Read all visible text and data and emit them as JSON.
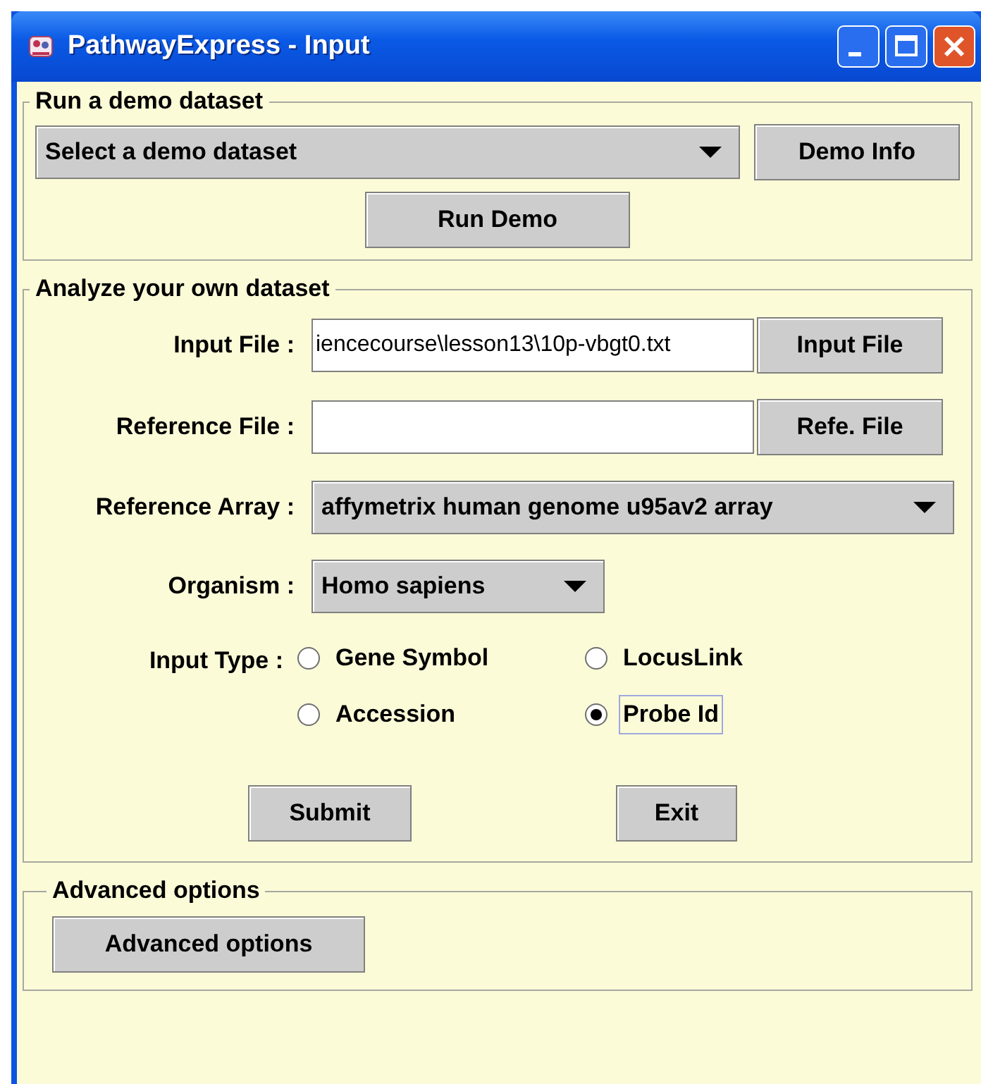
{
  "window": {
    "title": "PathwayExpress - Input"
  },
  "demo": {
    "legend": "Run a demo dataset",
    "dropdown": {
      "value": "Select a demo dataset"
    },
    "info_button": "Demo Info",
    "run_button": "Run Demo"
  },
  "analyze": {
    "legend": "Analyze your own dataset",
    "input_file": {
      "label": "Input File :",
      "value": "iencecourse\\lesson13\\10p-vbgt0.txt",
      "button": "Input File"
    },
    "reference_file": {
      "label": "Reference File :",
      "button": "Refe. File"
    },
    "reference_array": {
      "label": "Reference Array :",
      "value": "affymetrix human genome u95av2 array"
    },
    "organism": {
      "label": "Organism :",
      "value": "Homo sapiens"
    },
    "input_type": {
      "label": "Input Type :",
      "options": [
        {
          "label": "Gene Symbol",
          "selected": false
        },
        {
          "label": "LocusLink",
          "selected": false
        },
        {
          "label": "Accession",
          "selected": false
        },
        {
          "label": "Probe Id",
          "selected": true
        }
      ]
    },
    "submit_button": "Submit",
    "exit_button": "Exit"
  },
  "advanced": {
    "legend": "Advanced options",
    "button": "Advanced options"
  }
}
